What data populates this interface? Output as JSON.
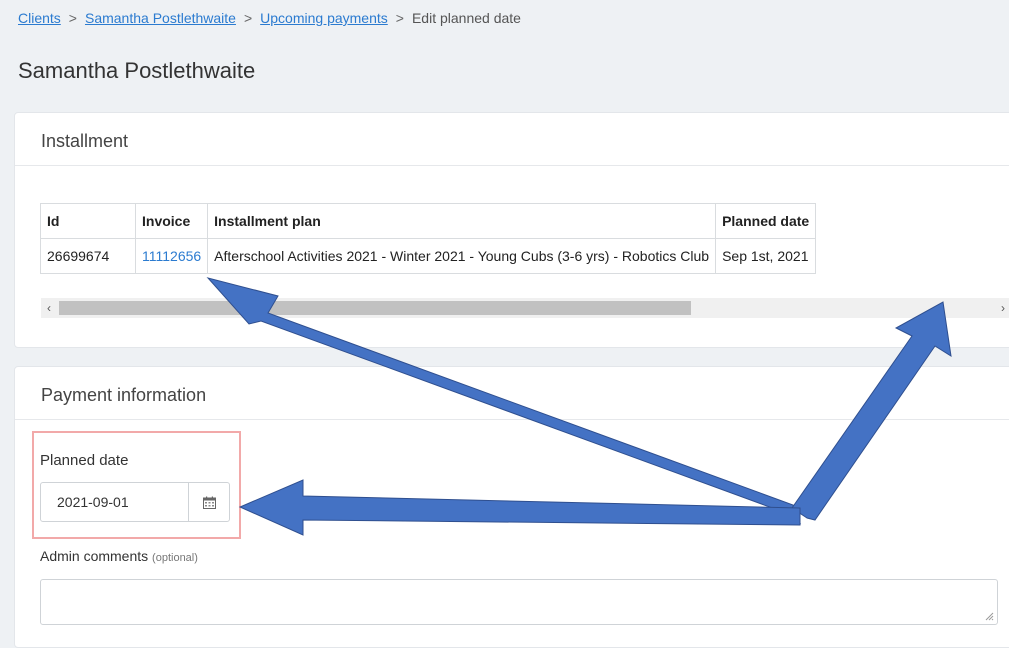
{
  "breadcrumb": {
    "items": [
      "Clients",
      "Samantha Postlethwaite",
      "Upcoming payments"
    ],
    "current": "Edit planned date",
    "separator": ">"
  },
  "page": {
    "title": "Samantha Postlethwaite"
  },
  "installment": {
    "header": "Installment",
    "columns": [
      "Id",
      "Invoice",
      "Installment plan",
      "Planned date"
    ],
    "row": {
      "id": "26699674",
      "invoice": "11112656",
      "plan": "Afterschool Activities 2021 - Winter 2021 - Young Cubs (3-6 yrs) - Robotics Club",
      "planned_date": "Sep 1st, 2021"
    },
    "scroll_left": "‹",
    "scroll_right": "›"
  },
  "payment": {
    "header": "Payment information",
    "planned_date_label": "Planned date",
    "planned_date_value": "2021-09-01",
    "admin_comments_label": "Admin comments",
    "admin_comments_optional": "(optional)",
    "admin_comments_value": ""
  },
  "colors": {
    "link": "#2b7bd0",
    "arrow": "#4472c4",
    "highlight": "#f2a9a9"
  },
  "icons": {
    "calendar": "calendar-icon",
    "resize": "resize-handle-icon"
  }
}
